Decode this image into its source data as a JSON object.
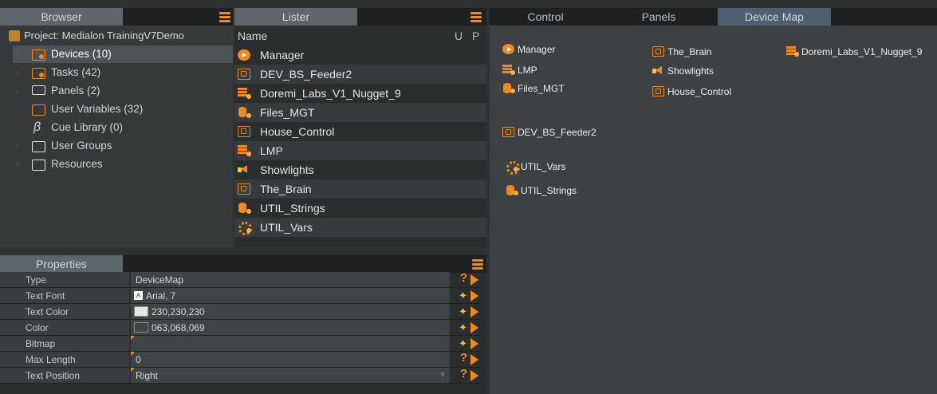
{
  "colors": {
    "accent": "#f08a1c",
    "panel_bg": "#2b2e2f",
    "map_bg": "#3d4143"
  },
  "browser": {
    "tab_label": "Browser",
    "project_label": "Project: Medialon TrainingV7Demo",
    "items": [
      {
        "label": "Devices (10)",
        "icon": "devices-folder-icon"
      },
      {
        "label": "Tasks (42)",
        "icon": "tasks-folder-icon"
      },
      {
        "label": "Panels (2)",
        "icon": "monitor-icon"
      },
      {
        "label": "User Variables (32)",
        "icon": "variables-folder-icon"
      },
      {
        "label": "Cue Library (0)",
        "icon": "lightning-icon"
      },
      {
        "label": "User Groups",
        "icon": "folder-icon"
      },
      {
        "label": "Resources",
        "icon": "folder-icon"
      }
    ]
  },
  "lister": {
    "tab_label": "Lister",
    "col_name": "Name",
    "col_u": "U",
    "col_p": "P",
    "rows": [
      {
        "name": "Manager",
        "icon": "play-circle-icon"
      },
      {
        "name": "DEV_BS_Feeder2",
        "icon": "monitor-device-icon"
      },
      {
        "name": "Doremi_Labs_V1_Nugget_9",
        "icon": "server-stack-icon"
      },
      {
        "name": "Files_MGT",
        "icon": "database-icon"
      },
      {
        "name": "House_Control",
        "icon": "monitor-device-icon"
      },
      {
        "name": "LMP",
        "icon": "server-stack-icon"
      },
      {
        "name": "Showlights",
        "icon": "horn-icon"
      },
      {
        "name": "The_Brain",
        "icon": "monitor-device-icon"
      },
      {
        "name": "UTIL_Strings",
        "icon": "database-icon"
      },
      {
        "name": "UTIL_Vars",
        "icon": "gear-icon"
      }
    ]
  },
  "properties": {
    "tab_label": "Properties",
    "rows": [
      {
        "key": "Type",
        "value": "DeviceMap",
        "button": "help"
      },
      {
        "key": "Text Font",
        "value": "Arial, 7",
        "button": "wand",
        "font_badge": "A"
      },
      {
        "key": "Text Color",
        "value": "230,230,230",
        "button": "wand",
        "swatch": "#e6e6e6"
      },
      {
        "key": "Color",
        "value": "063,068,069",
        "button": "wand",
        "swatch": "#3f4445"
      },
      {
        "key": "Bitmap",
        "value": "",
        "button": "wand"
      },
      {
        "key": "Max Length",
        "value": "0",
        "button": "help"
      },
      {
        "key": "Text Position",
        "value": "Right",
        "button": "help"
      }
    ]
  },
  "right_tabs": [
    "Control",
    "Panels",
    "Device Map"
  ],
  "device_map": {
    "items": [
      {
        "label": "Manager",
        "icon": "play-circle-icon"
      },
      {
        "label": "LMP",
        "icon": "server-stack-icon"
      },
      {
        "label": "Files_MGT",
        "icon": "database-icon"
      },
      {
        "label": "DEV_BS_Feeder2",
        "icon": "monitor-device-icon"
      },
      {
        "label": "UTIL_Vars",
        "icon": "gear-icon"
      },
      {
        "label": "UTIL_Strings",
        "icon": "database-icon"
      },
      {
        "label": "The_Brain",
        "icon": "monitor-device-icon"
      },
      {
        "label": "Showlights",
        "icon": "horn-icon"
      },
      {
        "label": "House_Control",
        "icon": "monitor-device-icon"
      },
      {
        "label": "Doremi_Labs_V1_Nugget_9",
        "icon": "server-stack-icon"
      }
    ]
  }
}
